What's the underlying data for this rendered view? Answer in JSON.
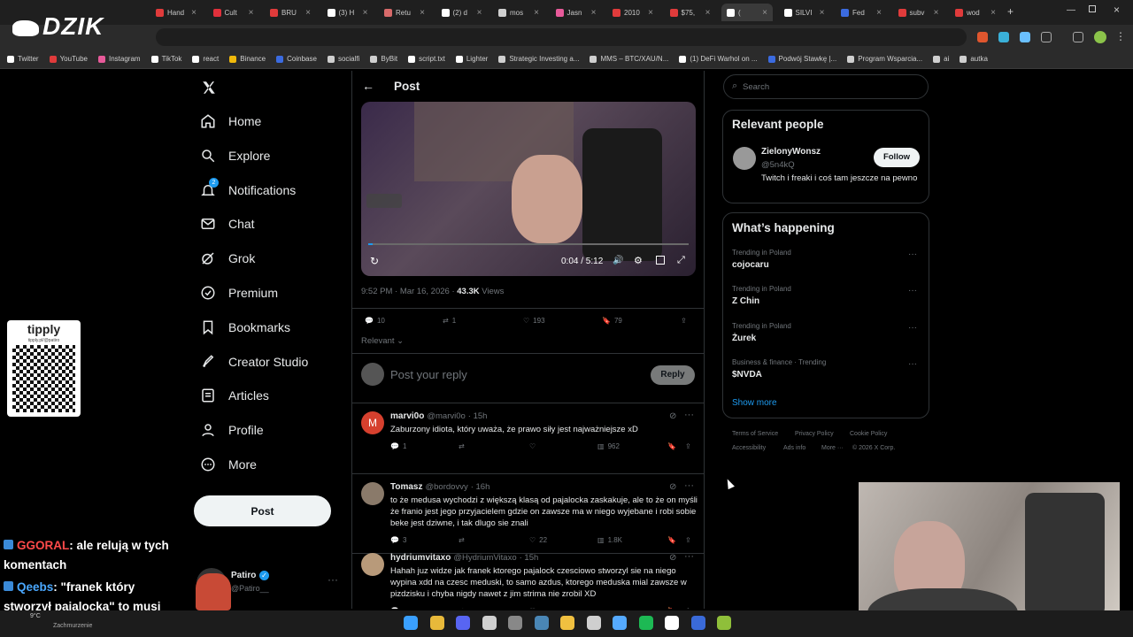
{
  "browser": {
    "tabs": [
      {
        "label": "Hand",
        "color": "#e03b3b"
      },
      {
        "label": "Cult",
        "color": "#e0303b"
      },
      {
        "label": "BRU",
        "color": "#e03b3b"
      },
      {
        "label": "(3) H",
        "color": "#ffffff"
      },
      {
        "label": "Retu",
        "color": "#d86a6a"
      },
      {
        "label": "(2) d",
        "color": "#ffffff"
      },
      {
        "label": "mos",
        "color": "#cfcfcf"
      },
      {
        "label": "Jasn",
        "color": "#e85a9a"
      },
      {
        "label": "2010",
        "color": "#e03b3b"
      },
      {
        "label": "$75,",
        "color": "#e03b3b"
      },
      {
        "label": "(",
        "color": "#ffffff"
      },
      {
        "label": "SILVI",
        "color": "#ffffff"
      },
      {
        "label": "Fed",
        "color": "#3b6be0"
      },
      {
        "label": "subv",
        "color": "#e03b3b"
      },
      {
        "label": "wod",
        "color": "#e03b3b"
      }
    ],
    "new_tab_symbol": "+",
    "bookmarks": [
      {
        "label": "Twitter",
        "color": "#ffffff"
      },
      {
        "label": "YouTube",
        "color": "#e03b3b"
      },
      {
        "label": "Instagram",
        "color": "#e85a9a"
      },
      {
        "label": "TikTok",
        "color": "#ffffff"
      },
      {
        "label": "react",
        "color": "#ffffff"
      },
      {
        "label": "Binance",
        "color": "#f0b90b"
      },
      {
        "label": "Coinbase",
        "color": "#3b6be0"
      },
      {
        "label": "socialfi",
        "color": "#cfcfcf"
      },
      {
        "label": "ByBit",
        "color": "#cfcfcf"
      },
      {
        "label": "script.txt",
        "color": "#ffffff"
      },
      {
        "label": "Lighter",
        "color": "#ffffff"
      },
      {
        "label": "Strategic Investing a...",
        "color": "#cfcfcf"
      },
      {
        "label": "MMS – BTC/XAU/N...",
        "color": "#cfcfcf"
      },
      {
        "label": "(1) DeFi Warhol on ...",
        "color": "#ffffff"
      },
      {
        "label": "Podwój Stawkę |...",
        "color": "#3b6be0"
      },
      {
        "label": "Program Wsparcia...",
        "color": "#cfcfcf"
      },
      {
        "label": "ai",
        "color": "#cfcfcf"
      },
      {
        "label": "autka",
        "color": "#cfcfcf"
      }
    ]
  },
  "overlay": {
    "logo_text": "DZIK",
    "tippy_text": "tipply",
    "tippy_sub": "tipply.pl/@patiro",
    "chat": [
      {
        "user": "GGORAL",
        "user_color": "#ff4a4a",
        "text": ": ale relują w tych komentach"
      },
      {
        "user": "Qeebs",
        "user_color": "#4aa8ff",
        "text": ": \"franek który stworzył pajalocka\" to musi być bait"
      }
    ]
  },
  "nav": {
    "items": [
      {
        "label": "Home",
        "icon": "home-icon"
      },
      {
        "label": "Explore",
        "icon": "search-icon"
      },
      {
        "label": "Notifications",
        "icon": "bell-icon",
        "badge": "2"
      },
      {
        "label": "Chat",
        "icon": "mail-icon"
      },
      {
        "label": "Grok",
        "icon": "grok-icon"
      },
      {
        "label": "Premium",
        "icon": "premium-icon"
      },
      {
        "label": "Bookmarks",
        "icon": "bookmark-icon"
      },
      {
        "label": "Creator Studio",
        "icon": "rocket-icon"
      },
      {
        "label": "Articles",
        "icon": "articles-icon"
      },
      {
        "label": "Profile",
        "icon": "profile-icon"
      },
      {
        "label": "More",
        "icon": "more-icon"
      }
    ],
    "post_button": "Post",
    "account": {
      "name": "Patiro",
      "handle": "@Patiro__"
    }
  },
  "post": {
    "header": "Post",
    "video": {
      "time": "0:04 / 5:12",
      "progress": 0.013
    },
    "timestamp": "9:52 PM · Mar 16, 2026 · ",
    "views_count": "43.3K",
    "views_label": " Views",
    "stats": {
      "replies": "10",
      "reposts": "1",
      "likes": "193",
      "bookmarks": "79"
    },
    "sort_label": "Relevant",
    "reply_placeholder": "Post your reply",
    "reply_button": "Reply"
  },
  "replies": [
    {
      "name": "marvi0o",
      "handle": "@marvi0o",
      "time": "· 15h",
      "text": "Zaburzony idiota, który uważa, że prawo siły jest najważniejsze xD",
      "replies": "1",
      "reposts": "",
      "likes": "",
      "views": "962",
      "avatar_letter": "M",
      "avatar_color": "#d6402e"
    },
    {
      "name": "Tomasz",
      "handle": "@bordovvy",
      "time": "· 16h",
      "text": "to że medusa wychodzi z większą klasą od pajalocka zaskakuje, ale to że on myśli że franio jest jego przyjacielem gdzie on zawsze ma w niego wyjebane i robi sobie beke jest dziwne, i tak dlugo sie znali",
      "replies": "3",
      "reposts": "",
      "likes": "22",
      "views": "1.8K",
      "avatar_letter": "",
      "avatar_color": "#8a7a6a"
    },
    {
      "name": "hydriumvitaxo",
      "handle": "@HydriumVitaxo",
      "time": "· 15h",
      "text": "Hahah juz widze jak franek ktorego pajalock czesciowo stworzyl sie na niego wypina xdd na czesc meduski, to samo azdus, ktorego meduska mial zawsze w pizdzisku i chyba nigdy nawet z jim strima nie zrobil XD",
      "replies": "",
      "reposts": "",
      "likes": "",
      "views": "",
      "avatar_letter": "",
      "avatar_color": "#b89a7a"
    }
  ],
  "right": {
    "search_placeholder": "Search",
    "relevant_people_title": "Relevant people",
    "person": {
      "name": "ZielonyWonsz",
      "handle": "@5n4kQ",
      "bio": "Twitch i freaki i coś tam jeszcze na pewno",
      "follow_label": "Follow"
    },
    "happening_title": "What’s happening",
    "trends": [
      {
        "context": "Trending in Poland",
        "topic": "cojocaru"
      },
      {
        "context": "Trending in Poland",
        "topic": "Z Chin"
      },
      {
        "context": "Trending in Poland",
        "topic": "Żurek"
      },
      {
        "context": "Business & finance · Trending",
        "topic": "$NVDA"
      }
    ],
    "show_more": "Show more",
    "footer": [
      "Terms of Service",
      "Privacy Policy",
      "Cookie Policy",
      "Accessibility",
      "Ads info",
      "More ···",
      "© 2026 X Corp."
    ]
  },
  "taskbar": {
    "weather": "9°C",
    "weather_text": "Zachmurzenie",
    "icons": [
      {
        "name": "windows-start-icon",
        "color": "#3aa0ff"
      },
      {
        "name": "chrome-icon",
        "color": "#e8b93a"
      },
      {
        "name": "discord-icon",
        "color": "#5865f2"
      },
      {
        "name": "app-icon",
        "color": "#cfcfcf"
      },
      {
        "name": "obs-icon",
        "color": "#888888"
      },
      {
        "name": "steam-icon",
        "color": "#4a86b5"
      },
      {
        "name": "folder-icon",
        "color": "#f0c040"
      },
      {
        "name": "ccleaner-icon",
        "color": "#cfcfcf"
      },
      {
        "name": "network-icon",
        "color": "#55aaff"
      },
      {
        "name": "spotify-icon",
        "color": "#1db954"
      },
      {
        "name": "app2-icon",
        "color": "#ffffff"
      },
      {
        "name": "x-app-icon",
        "color": "#3a6ad8"
      },
      {
        "name": "app3-icon",
        "color": "#8fbf3a"
      }
    ]
  }
}
